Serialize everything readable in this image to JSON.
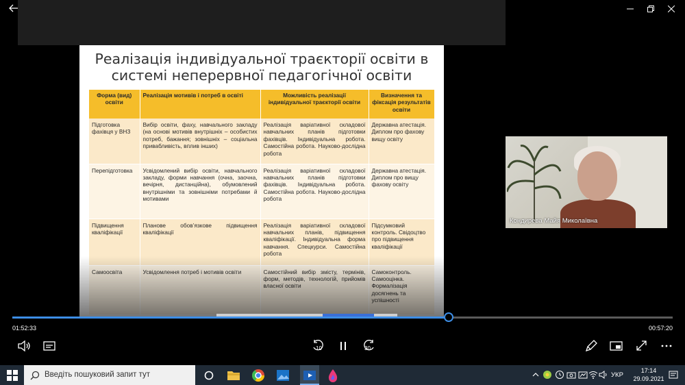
{
  "slide": {
    "title_line1": "Реалізація індивідуальної траєкторії освіти в",
    "title_line2": "системі неперервної педагогічної освіти",
    "headers": [
      "Форма (вид) освіти",
      "Реалізація мотивів і потреб в освіті",
      "Можливість реалізації індивідуальної траєкторії освіти",
      "Визначення та фіксація результатів освіти"
    ],
    "rows": [
      [
        "Підготовка фахівця у ВНЗ",
        "Вибір освіти, фаху, навчального закладу (на основі мотивів внутрішніх – особистих потреб, бажання; зовнішніх – соціальна привабливість, вплив інших)",
        "Реалізація варіативної складової навчальних планів підготовки фахівців. Індивідуальна робота. Самостійна робота. Науково-дослідна робота",
        "Державна атестація. Диплом про фахову вищу освіту"
      ],
      [
        "Перепідготовка",
        "Усвідомлений вибір освіти, навчального закладу, форми навчання (очна, заочна, вечірня, дистанційна), обумовлений внутрішніми та зовнішніми потребами й мотивами",
        "Реалізація варіативної складової навчальних планів підготовки фахівців. Індивідуальна робота. Самостійна робота. Науково-дослідна робота",
        "Державна атестація. Диплом про вищу фахову освіту"
      ],
      [
        "Підвищення кваліфікації",
        "Планове обов’язкове підвищення кваліфікації",
        "Реалізація варіативної складової навчальних планів, підвищення кваліфікації. Індивідуальна форма навчання. Спецкурси. Самостійна робота",
        "Підсумковий контроль. Свідоцтво про підвищення кваліфікації"
      ],
      [
        "Самоосвіта",
        "Усвідомлення потреб і мотивів освіти",
        "Самостійний вибір змісту, термінів, форм, методів, технологій, прийомів власної освіти",
        "Самоконтроль. Самооцінка. Формалізація досягнень та успішності"
      ]
    ]
  },
  "webcam": {
    "participant_name": "Кондирева Майя Миколаївна"
  },
  "player": {
    "elapsed": "01:52:33",
    "remaining": "00:57:20",
    "progress_fraction": 0.661,
    "skip_back": "10",
    "skip_forward": "30"
  },
  "taskbar": {
    "search_placeholder": "Введіть пошуковий запит тут",
    "language": "УКР",
    "time": "17:14",
    "date": "29.09.2021"
  },
  "colors": {
    "accent": "#3d8ee6",
    "table_header": "#f5bd2a",
    "taskbar": "#1f2a36"
  }
}
